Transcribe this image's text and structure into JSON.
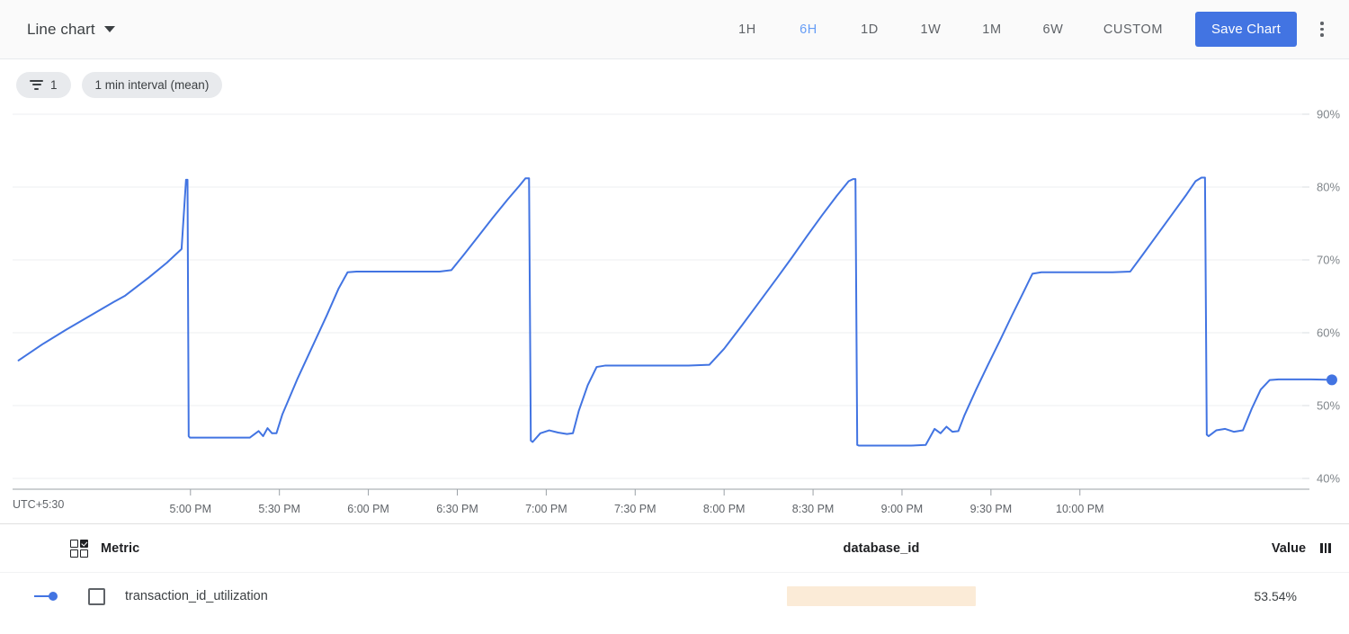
{
  "header": {
    "chart_type_label": "Line chart",
    "caret_icon": "chevron-down-icon",
    "ranges": [
      {
        "label": "1H",
        "active": false
      },
      {
        "label": "6H",
        "active": true
      },
      {
        "label": "1D",
        "active": false
      },
      {
        "label": "1W",
        "active": false
      },
      {
        "label": "1M",
        "active": false
      },
      {
        "label": "6W",
        "active": false
      },
      {
        "label": "CUSTOM",
        "active": false
      }
    ],
    "save_label": "Save Chart",
    "kebab_icon": "more-vertical-icon",
    "accent_color": "#4274e2",
    "active_range_color": "#669df6"
  },
  "chips": {
    "filter_icon": "filter-list-icon",
    "filter_count": "1",
    "interval_label": "1 min interval (mean)"
  },
  "legend": {
    "select_all_icon": "select-all-checkbox-icon",
    "metric_header": "Metric",
    "dimension_header": "database_id",
    "value_header": "Value",
    "column_settings_icon": "column-settings-icon",
    "rows": [
      {
        "series_color": "#4274e2",
        "checked": false,
        "name": "transaction_id_utilization",
        "database_id": "",
        "database_id_redacted": true,
        "redact_color": "#fbebd7",
        "value": "53.54%"
      }
    ]
  },
  "chart_data": {
    "type": "line",
    "title": "",
    "xlabel": "",
    "ylabel": "",
    "timezone_label": "UTC+5:30",
    "grid": true,
    "legend_position": "bottom-table",
    "ylim": [
      40,
      90
    ],
    "yticks": [
      90,
      80,
      70,
      60,
      50,
      40
    ],
    "ytick_labels": [
      "90%",
      "80%",
      "70%",
      "60%",
      "50%",
      "40%"
    ],
    "xticks": [
      "5:00 PM",
      "5:30 PM",
      "6:00 PM",
      "6:30 PM",
      "7:00 PM",
      "7:30 PM",
      "8:00 PM",
      "8:30 PM",
      "9:00 PM",
      "9:30 PM",
      "10:00 PM"
    ],
    "xlim_minutes": [
      -60,
      375
    ],
    "series": [
      {
        "name": "transaction_id_utilization",
        "color": "#4274e2",
        "unit": "%",
        "last_value": 53.54,
        "end_marker": true,
        "points": [
          [
            -58,
            56.2
          ],
          [
            -50,
            58.4
          ],
          [
            -42,
            60.4
          ],
          [
            -34,
            62.3
          ],
          [
            -26,
            64.2
          ],
          [
            -22,
            65.1
          ],
          [
            -14,
            67.6
          ],
          [
            -8,
            69.6
          ],
          [
            -3,
            71.5
          ],
          [
            -1.5,
            81.0
          ],
          [
            -1.0,
            81.0
          ],
          [
            -0.6,
            45.8
          ],
          [
            -0.2,
            45.6
          ],
          [
            12,
            45.6
          ],
          [
            20,
            45.6
          ],
          [
            23,
            46.5
          ],
          [
            24.5,
            45.8
          ],
          [
            26,
            46.9
          ],
          [
            27.5,
            46.2
          ],
          [
            29,
            46.2
          ],
          [
            31,
            48.8
          ],
          [
            36,
            53.6
          ],
          [
            41,
            58.0
          ],
          [
            46,
            62.4
          ],
          [
            50,
            66.1
          ],
          [
            53,
            68.3
          ],
          [
            56,
            68.4
          ],
          [
            62,
            68.4
          ],
          [
            70,
            68.4
          ],
          [
            78,
            68.4
          ],
          [
            84,
            68.4
          ],
          [
            88,
            68.6
          ],
          [
            92,
            70.6
          ],
          [
            97,
            73.2
          ],
          [
            102,
            75.8
          ],
          [
            107,
            78.3
          ],
          [
            111,
            80.2
          ],
          [
            113,
            81.2
          ],
          [
            114.2,
            81.2
          ],
          [
            114.8,
            45.2
          ],
          [
            115.4,
            45.0
          ],
          [
            118,
            46.2
          ],
          [
            121,
            46.6
          ],
          [
            124,
            46.3
          ],
          [
            127,
            46.1
          ],
          [
            129,
            46.2
          ],
          [
            131,
            49.3
          ],
          [
            134,
            52.8
          ],
          [
            137,
            55.3
          ],
          [
            140,
            55.5
          ],
          [
            148,
            55.5
          ],
          [
            158,
            55.5
          ],
          [
            168,
            55.5
          ],
          [
            175,
            55.6
          ],
          [
            180,
            57.8
          ],
          [
            186,
            61.0
          ],
          [
            192,
            64.3
          ],
          [
            198,
            67.6
          ],
          [
            203,
            70.4
          ],
          [
            208,
            73.3
          ],
          [
            213,
            76.1
          ],
          [
            218,
            78.8
          ],
          [
            222,
            80.8
          ],
          [
            223.5,
            81.1
          ],
          [
            224.3,
            81.1
          ],
          [
            224.9,
            44.6
          ],
          [
            225.5,
            44.5
          ],
          [
            234,
            44.5
          ],
          [
            243,
            44.5
          ],
          [
            248,
            44.6
          ],
          [
            251,
            46.8
          ],
          [
            253,
            46.2
          ],
          [
            255,
            47.1
          ],
          [
            257,
            46.4
          ],
          [
            259,
            46.5
          ],
          [
            261,
            48.6
          ],
          [
            265,
            52.2
          ],
          [
            269,
            55.6
          ],
          [
            273,
            58.9
          ],
          [
            277,
            62.3
          ],
          [
            281,
            65.6
          ],
          [
            284,
            68.1
          ],
          [
            287,
            68.3
          ],
          [
            295,
            68.3
          ],
          [
            303,
            68.3
          ],
          [
            311,
            68.3
          ],
          [
            317,
            68.4
          ],
          [
            321,
            70.6
          ],
          [
            326,
            73.4
          ],
          [
            331,
            76.2
          ],
          [
            336,
            79.0
          ],
          [
            339,
            80.8
          ],
          [
            341,
            81.3
          ],
          [
            342.2,
            81.3
          ],
          [
            342.8,
            46.0
          ],
          [
            343.4,
            45.8
          ],
          [
            346,
            46.6
          ],
          [
            349,
            46.8
          ],
          [
            352,
            46.4
          ],
          [
            355,
            46.6
          ],
          [
            358,
            49.6
          ],
          [
            361,
            52.2
          ],
          [
            364,
            53.5
          ],
          [
            367,
            53.6
          ],
          [
            372,
            53.6
          ],
          [
            378,
            53.6
          ],
          [
            385,
            53.54
          ]
        ]
      }
    ]
  }
}
